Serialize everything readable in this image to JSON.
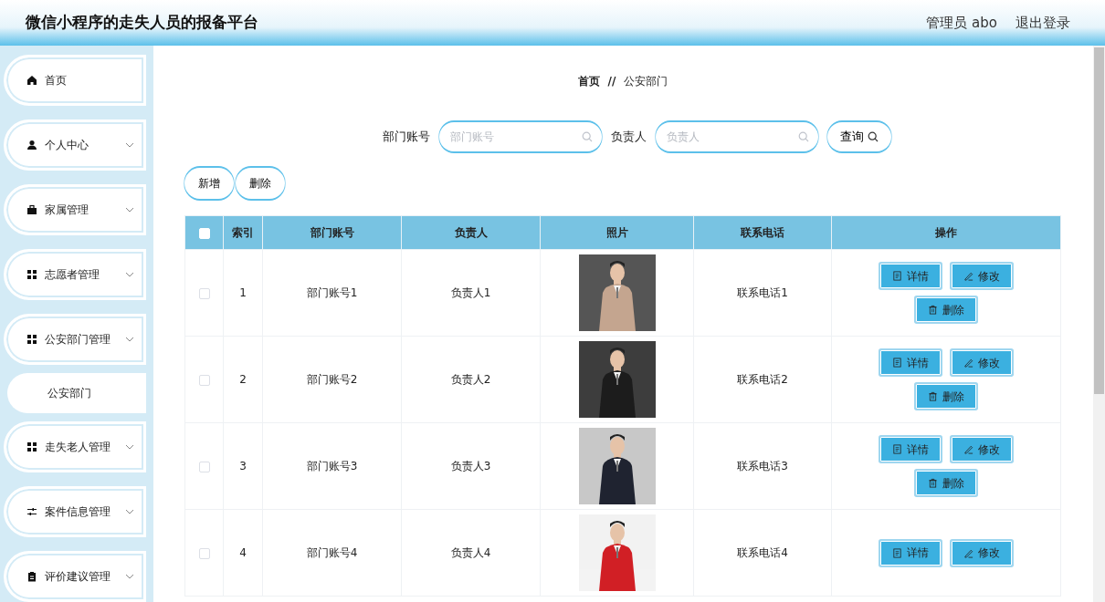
{
  "header": {
    "title": "微信小程序的走失人员的报备平台",
    "user": "管理员 abo",
    "logout": "退出登录"
  },
  "sidebar": {
    "items": [
      {
        "label": "首页",
        "expandable": false
      },
      {
        "label": "个人中心",
        "expandable": true
      },
      {
        "label": "家属管理",
        "expandable": true
      },
      {
        "label": "志愿者管理",
        "expandable": true
      },
      {
        "label": "公安部门管理",
        "expandable": true,
        "children": [
          {
            "label": "公安部门"
          }
        ]
      },
      {
        "label": "走失老人管理",
        "expandable": true
      },
      {
        "label": "案件信息管理",
        "expandable": true
      },
      {
        "label": "评价建议管理",
        "expandable": true
      }
    ]
  },
  "breadcrumb": {
    "home": "首页",
    "separator": "//",
    "current": "公安部门"
  },
  "search": {
    "fields": [
      {
        "label": "部门账号",
        "placeholder": "部门账号"
      },
      {
        "label": "负责人",
        "placeholder": "负责人"
      }
    ],
    "button": "查询"
  },
  "toolbar": [
    "新增",
    "删除"
  ],
  "table": {
    "select_all": {
      "checked": false
    },
    "columns": [
      "索引",
      "部门账号",
      "负责人",
      "照片",
      "联系电话",
      "操作"
    ],
    "rows": [
      {
        "checked": false,
        "index": "1",
        "account": "部门账号1",
        "person": "负责人1",
        "photo": {
          "kind": "picture"
        },
        "phone": "联系电话1",
        "actions": [
          "详情",
          "修改",
          "删除"
        ]
      },
      {
        "checked": false,
        "index": "2",
        "account": "部门账号2",
        "person": "负责人2",
        "photo": {
          "kind": "picture"
        },
        "phone": "联系电话2",
        "actions": [
          "详情",
          "修改",
          "删除"
        ]
      },
      {
        "checked": false,
        "index": "3",
        "account": "部门账号3",
        "person": "负责人3",
        "photo": {
          "kind": "picture"
        },
        "phone": "联系电话3",
        "actions": [
          "详情",
          "修改",
          "删除"
        ]
      },
      {
        "checked": false,
        "index": "4",
        "account": "部门账号4",
        "person": "负责人4",
        "photo": {
          "kind": "picture"
        },
        "phone": "联系电话4",
        "actions": [
          "详情",
          "修改"
        ]
      }
    ]
  }
}
